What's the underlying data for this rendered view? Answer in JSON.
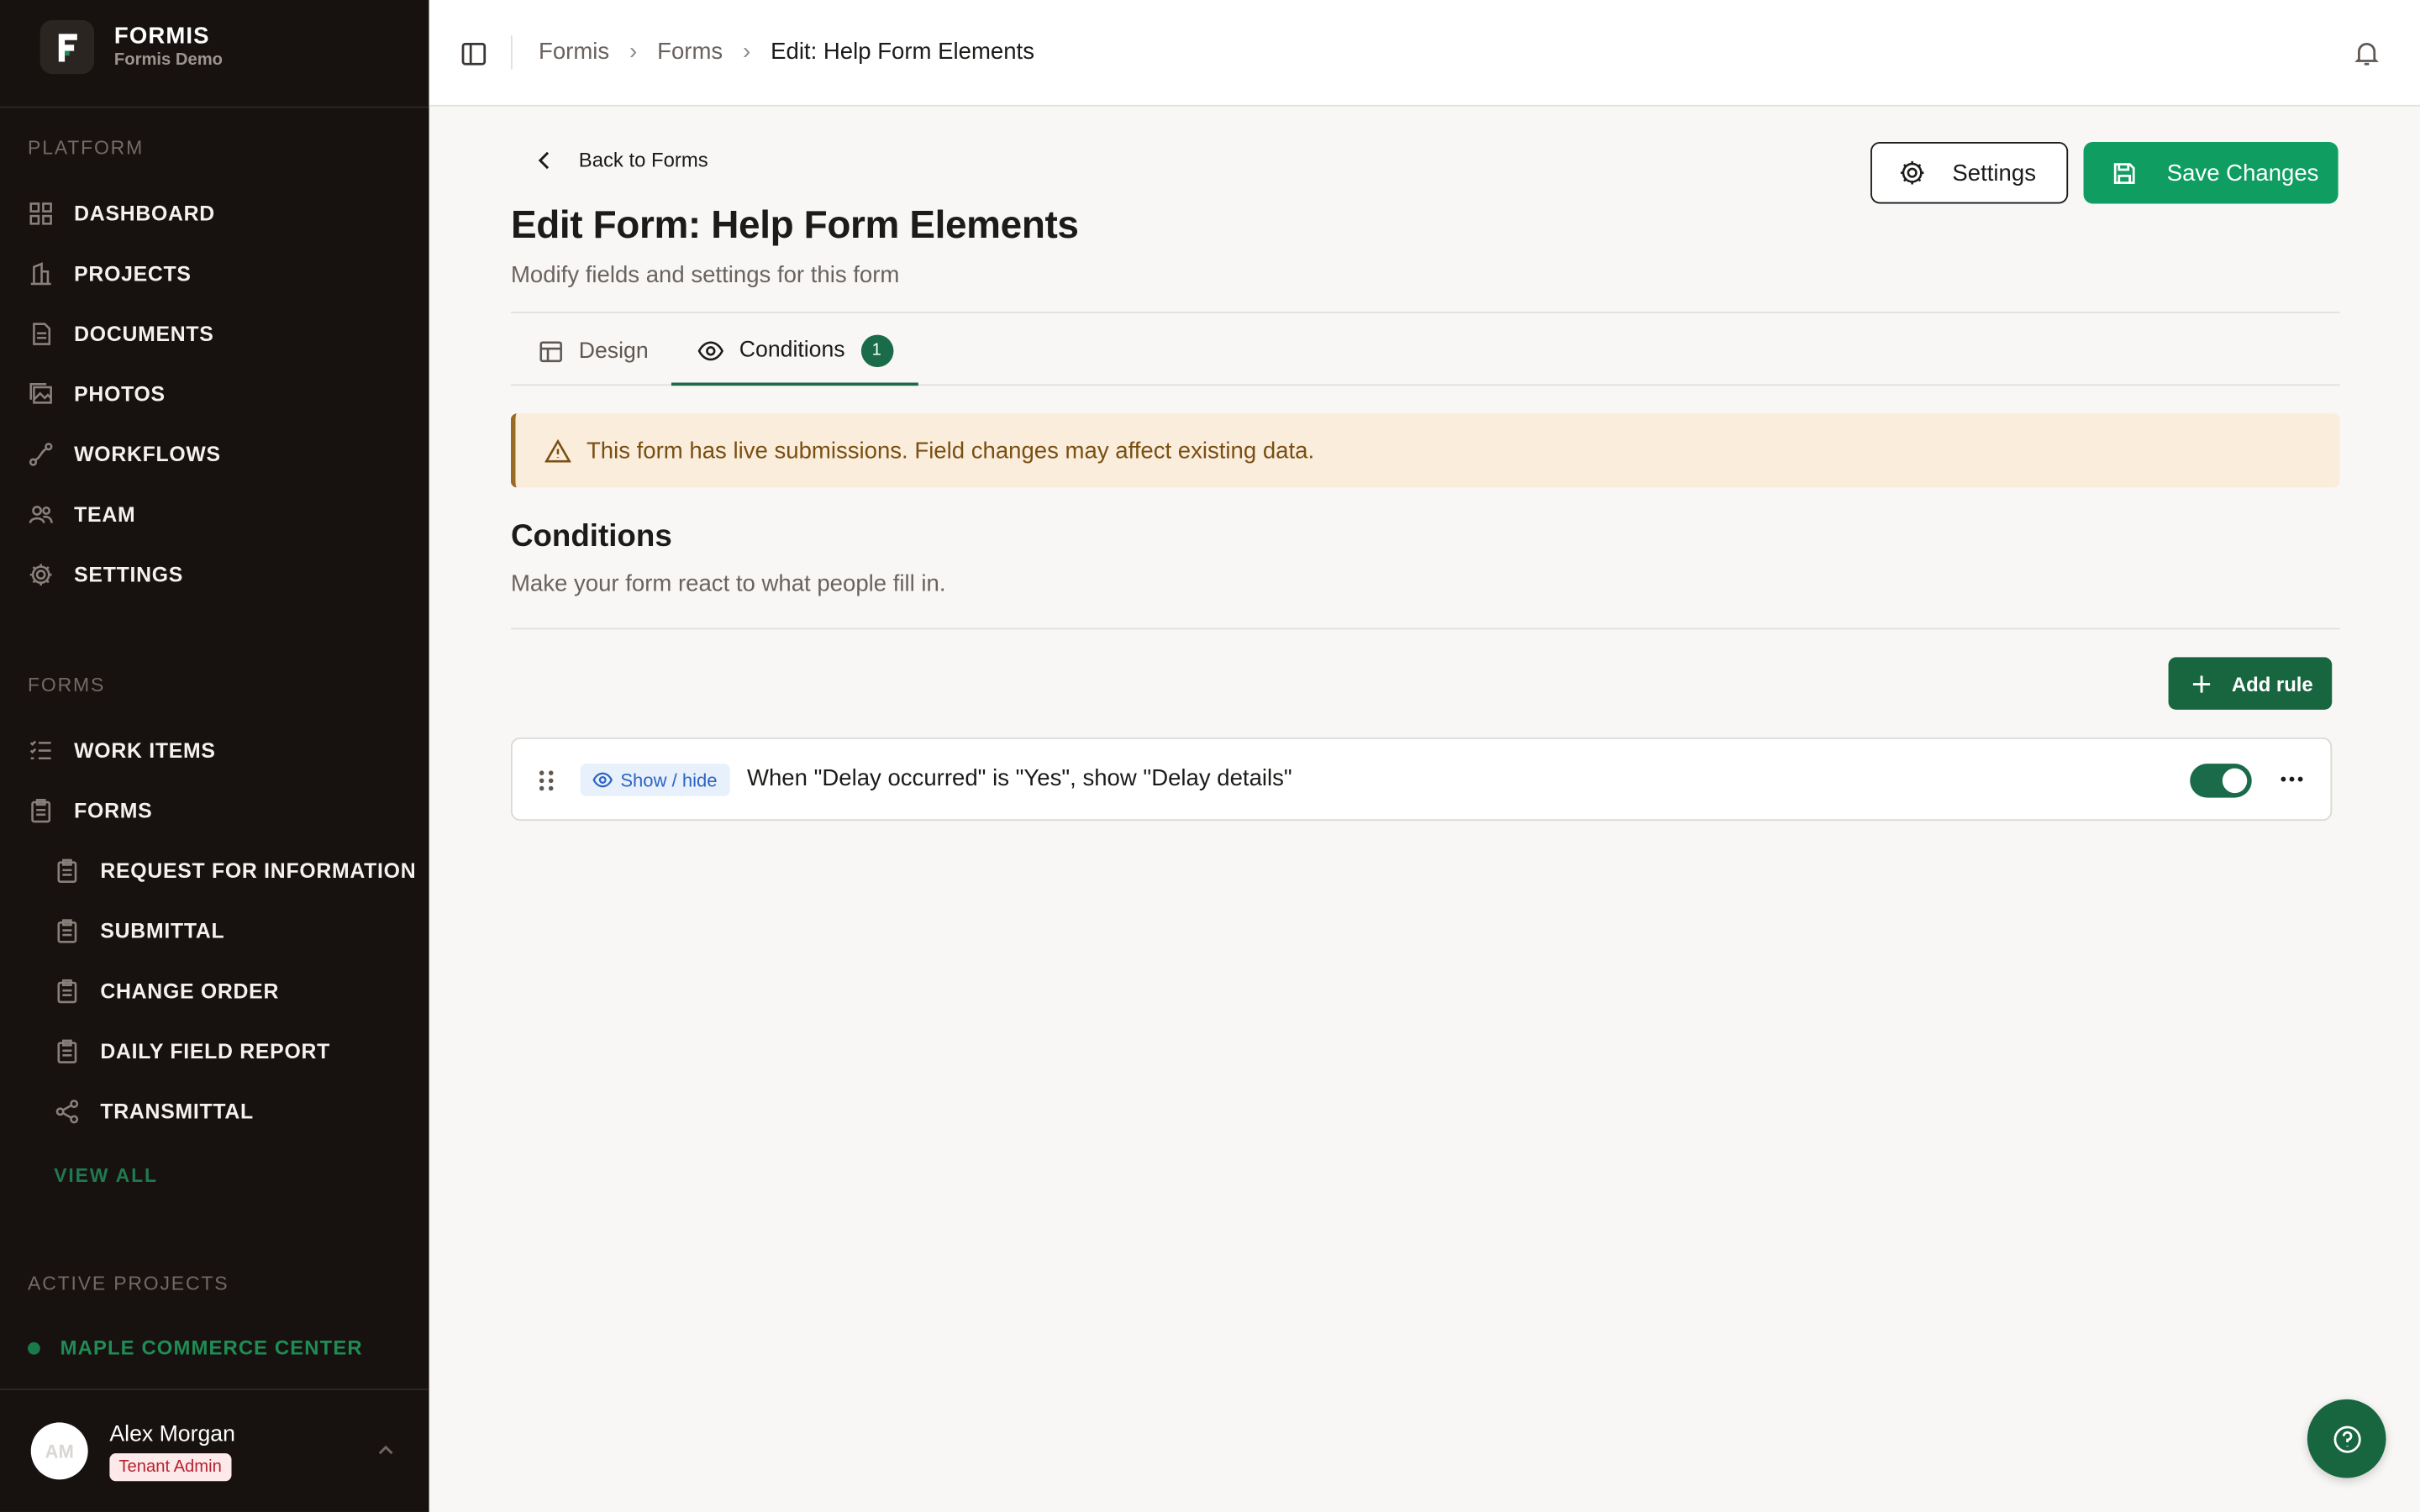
{
  "brand": {
    "name": "FORMIS",
    "subtitle": "Formis Demo",
    "logo_letter": "F"
  },
  "sidebar": {
    "platform_title": "PLATFORM",
    "platform_items": [
      {
        "label": "DASHBOARD",
        "icon": "grid-icon"
      },
      {
        "label": "PROJECTS",
        "icon": "building-icon"
      },
      {
        "label": "DOCUMENTS",
        "icon": "document-icon"
      },
      {
        "label": "PHOTOS",
        "icon": "photos-icon"
      },
      {
        "label": "WORKFLOWS",
        "icon": "workflow-icon"
      },
      {
        "label": "TEAM",
        "icon": "team-icon"
      },
      {
        "label": "SETTINGS",
        "icon": "gear-icon"
      }
    ],
    "forms_title": "FORMS",
    "forms_items": [
      {
        "label": "WORK ITEMS",
        "icon": "checklist-icon"
      },
      {
        "label": "FORMS",
        "icon": "clipboard-icon"
      }
    ],
    "form_types": [
      {
        "label": "REQUEST FOR INFORMATION",
        "icon": "clipboard-icon"
      },
      {
        "label": "SUBMITTAL",
        "icon": "clipboard-icon"
      },
      {
        "label": "CHANGE ORDER",
        "icon": "clipboard-icon"
      },
      {
        "label": "DAILY FIELD REPORT",
        "icon": "clipboard-icon"
      },
      {
        "label": "TRANSMITTAL",
        "icon": "share-icon"
      }
    ],
    "view_all": "VIEW ALL",
    "active_projects_title": "ACTIVE PROJECTS",
    "active_projects": [
      {
        "label": "MAPLE COMMERCE CENTER"
      }
    ]
  },
  "user": {
    "initials": "AM",
    "name": "Alex Morgan",
    "role": "Tenant Admin"
  },
  "breadcrumb": {
    "items": [
      "Formis",
      "Forms"
    ],
    "current": "Edit: Help Form Elements"
  },
  "page": {
    "back_label": "Back to Forms",
    "title": "Edit Form: Help Form Elements",
    "subtitle": "Modify fields and settings for this form",
    "settings_label": "Settings",
    "save_label": "Save Changes"
  },
  "tabs": [
    {
      "label": "Design"
    },
    {
      "label": "Conditions",
      "count": "1",
      "active": true
    }
  ],
  "alert": {
    "text": "This form has live submissions. Field changes may affect existing data."
  },
  "conditions": {
    "title": "Conditions",
    "subtitle": "Make your form react to what people fill in.",
    "add_rule_label": "Add rule",
    "rules": [
      {
        "type_label": "Show / hide",
        "text": "When \"Delay occurred\" is \"Yes\", show \"Delay details\"",
        "enabled": true
      }
    ]
  },
  "colors": {
    "sidebar_bg": "#171210",
    "primary_green": "#0f9d62",
    "dark_green": "#17663f",
    "alert_bg": "#faeddc",
    "alert_text": "#7a4f12",
    "badge_blue": "#2c64c4"
  }
}
